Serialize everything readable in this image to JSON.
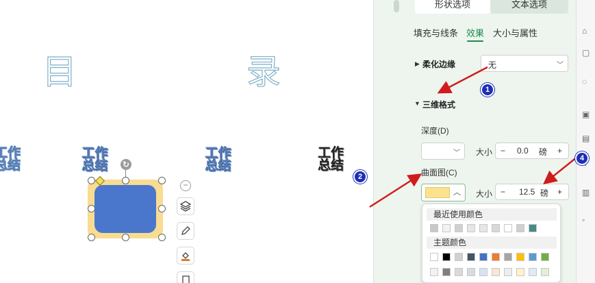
{
  "slide": {
    "heading_left": "目",
    "heading_right": "录",
    "wordart_items": [
      {
        "line1": "工作",
        "line2": "总结",
        "style": "blue"
      },
      {
        "line1": "工作",
        "line2": "总结",
        "style": "blue"
      },
      {
        "line1": "工作",
        "line2": "总结",
        "style": "outline"
      },
      {
        "line1": "工作",
        "line2": "总结",
        "style": "dark"
      }
    ],
    "shape": {
      "fill": "#4a77cc",
      "glow": "#f7dc92",
      "selected": true
    },
    "float_toolbar": [
      "collapse-icon",
      "layers-icon",
      "pen-icon",
      "fill-icon",
      "copy-icon"
    ]
  },
  "pane": {
    "tabs": {
      "shape_options": "形状选项",
      "text_options": "文本选项"
    },
    "subtabs": [
      "填充与线条",
      "效果",
      "大小与属性"
    ],
    "active_subtab": "效果",
    "soft_edge": {
      "label": "柔化边缘",
      "value": "无"
    },
    "three_d": {
      "label": "三维格式",
      "depth_label": "深度(D)",
      "depth_size_label": "大小",
      "depth_value": "0.0",
      "depth_unit": "磅",
      "contour_label": "曲面图(C)",
      "contour_size_label": "大小",
      "contour_value": "12.5",
      "contour_unit": "磅",
      "contour_color": "#fbe28f"
    },
    "palette": {
      "recent_label": "最近使用颜色",
      "theme_label": "主题颜色",
      "recent_colors": [
        "#c8c8c8",
        "#f2f2f2",
        "#d0d0d0",
        "#e6e6e6",
        "#e6e6e6",
        "#d8d8d8",
        "#ffffff",
        "#d0d0d0",
        "#458b86"
      ],
      "theme_colors": [
        "#ffffff",
        "#000000",
        "#d0d0d0",
        "#44546a",
        "#4472c4",
        "#ed7d31",
        "#a5a5a5",
        "#ffc000",
        "#5b9bd5",
        "#70ad47"
      ],
      "theme_tints": [
        "#f2f2f2",
        "#7f7f7f",
        "#d9d9d9",
        "#d6dce4",
        "#d9e2f3",
        "#fbe5d5",
        "#ededed",
        "#fff2cc",
        "#deebf6",
        "#e2efd9"
      ]
    }
  },
  "annotations": {
    "badge1": "1",
    "badge2": "2",
    "badge4": "4"
  },
  "colors": {
    "accent": "#1d8a4f",
    "arrow": "#d01c1c",
    "badge": "#1c2fb5"
  }
}
